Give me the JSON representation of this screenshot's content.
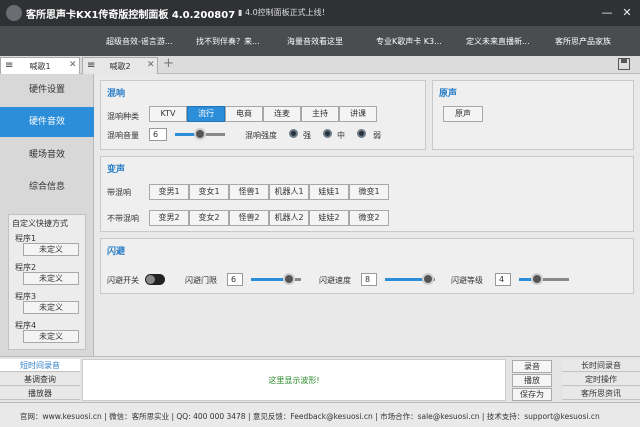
{
  "titlebar": {
    "title": "客所思声卡KX1传奇版控制面板 4.0.200807",
    "notice": "4.0控制面板正式上线！",
    "minimize": "—",
    "close": "✕"
  },
  "promos": [
    "超级音效-谣言游...",
    "找不到伴奏？来...",
    "海量音效看这里",
    "专业K歌声卡 K3...",
    "定义未来直播新...",
    "客所思产品家族"
  ],
  "tabs": [
    {
      "label": "喊歌1",
      "close": "✕"
    },
    {
      "label": "喊歌2",
      "close": "✕"
    }
  ],
  "tab_add": "+",
  "sidebar": {
    "items": [
      "硬件设置",
      "硬件音效",
      "暖场音效",
      "综合信息"
    ],
    "quick_title": "自定义快捷方式",
    "programs": [
      {
        "label": "程序1",
        "value": "未定义"
      },
      {
        "label": "程序2",
        "value": "未定义"
      },
      {
        "label": "程序3",
        "value": "未定义"
      },
      {
        "label": "程序4",
        "value": "未定义"
      }
    ]
  },
  "reverb": {
    "title": "混响",
    "type_label": "混响种类",
    "types": [
      "KTV",
      "流行",
      "电商",
      "连麦",
      "主持",
      "讲课"
    ],
    "selected_type": "流行",
    "volume_label": "混响音量",
    "volume_value": "6",
    "volume_level": 0.5,
    "strength_label": "混响强度",
    "strength_options": [
      "强",
      "中",
      "弱"
    ]
  },
  "original": {
    "title": "原声",
    "button": "原声"
  },
  "voice_change": {
    "title": "变声",
    "with_reverb_label": "带混响",
    "with_reverb": [
      "变男1",
      "变女1",
      "怪兽1",
      "机器人1",
      "娃娃1",
      "微变1"
    ],
    "without_reverb_label": "不带混响",
    "without_reverb": [
      "变男2",
      "变女2",
      "怪兽2",
      "机器人2",
      "娃娃2",
      "微变2"
    ]
  },
  "dodge": {
    "title": "闪避",
    "switch_label": "闪避开关",
    "threshold_label": "闪避门限",
    "threshold_value": "6",
    "threshold_level": 0.75,
    "speed_label": "闪避速度",
    "speed_value": "8",
    "speed_level": 0.85,
    "level_label": "闪避等级",
    "level_value": "4",
    "level_level": 0.35
  },
  "bottom": {
    "left_buttons": [
      "短时间录音",
      "基调查询",
      "播放器"
    ],
    "wave_message": "这里显示波形!",
    "mid_buttons": [
      "录音",
      "播放",
      "保存为MP3"
    ],
    "right_buttons": [
      "长时间录音",
      "定时操作",
      "客所思资讯"
    ]
  },
  "footer": {
    "text": "官网：www.kesuosi.cn  |  微信：客所思实业  |  QQ: 400 000 3478  |  意见反馈：Feedback@kesuosi.cn  |  市场合作：sale@kesuosi.cn  |  技术支持：support@kesuosi.cn"
  },
  "colors": {
    "accent": "#2c8ed8",
    "titlebar": "#2f3134",
    "promobar": "#4a4c50",
    "section_title": "#2c7fc8",
    "wave_text": "#2a8a2a"
  }
}
